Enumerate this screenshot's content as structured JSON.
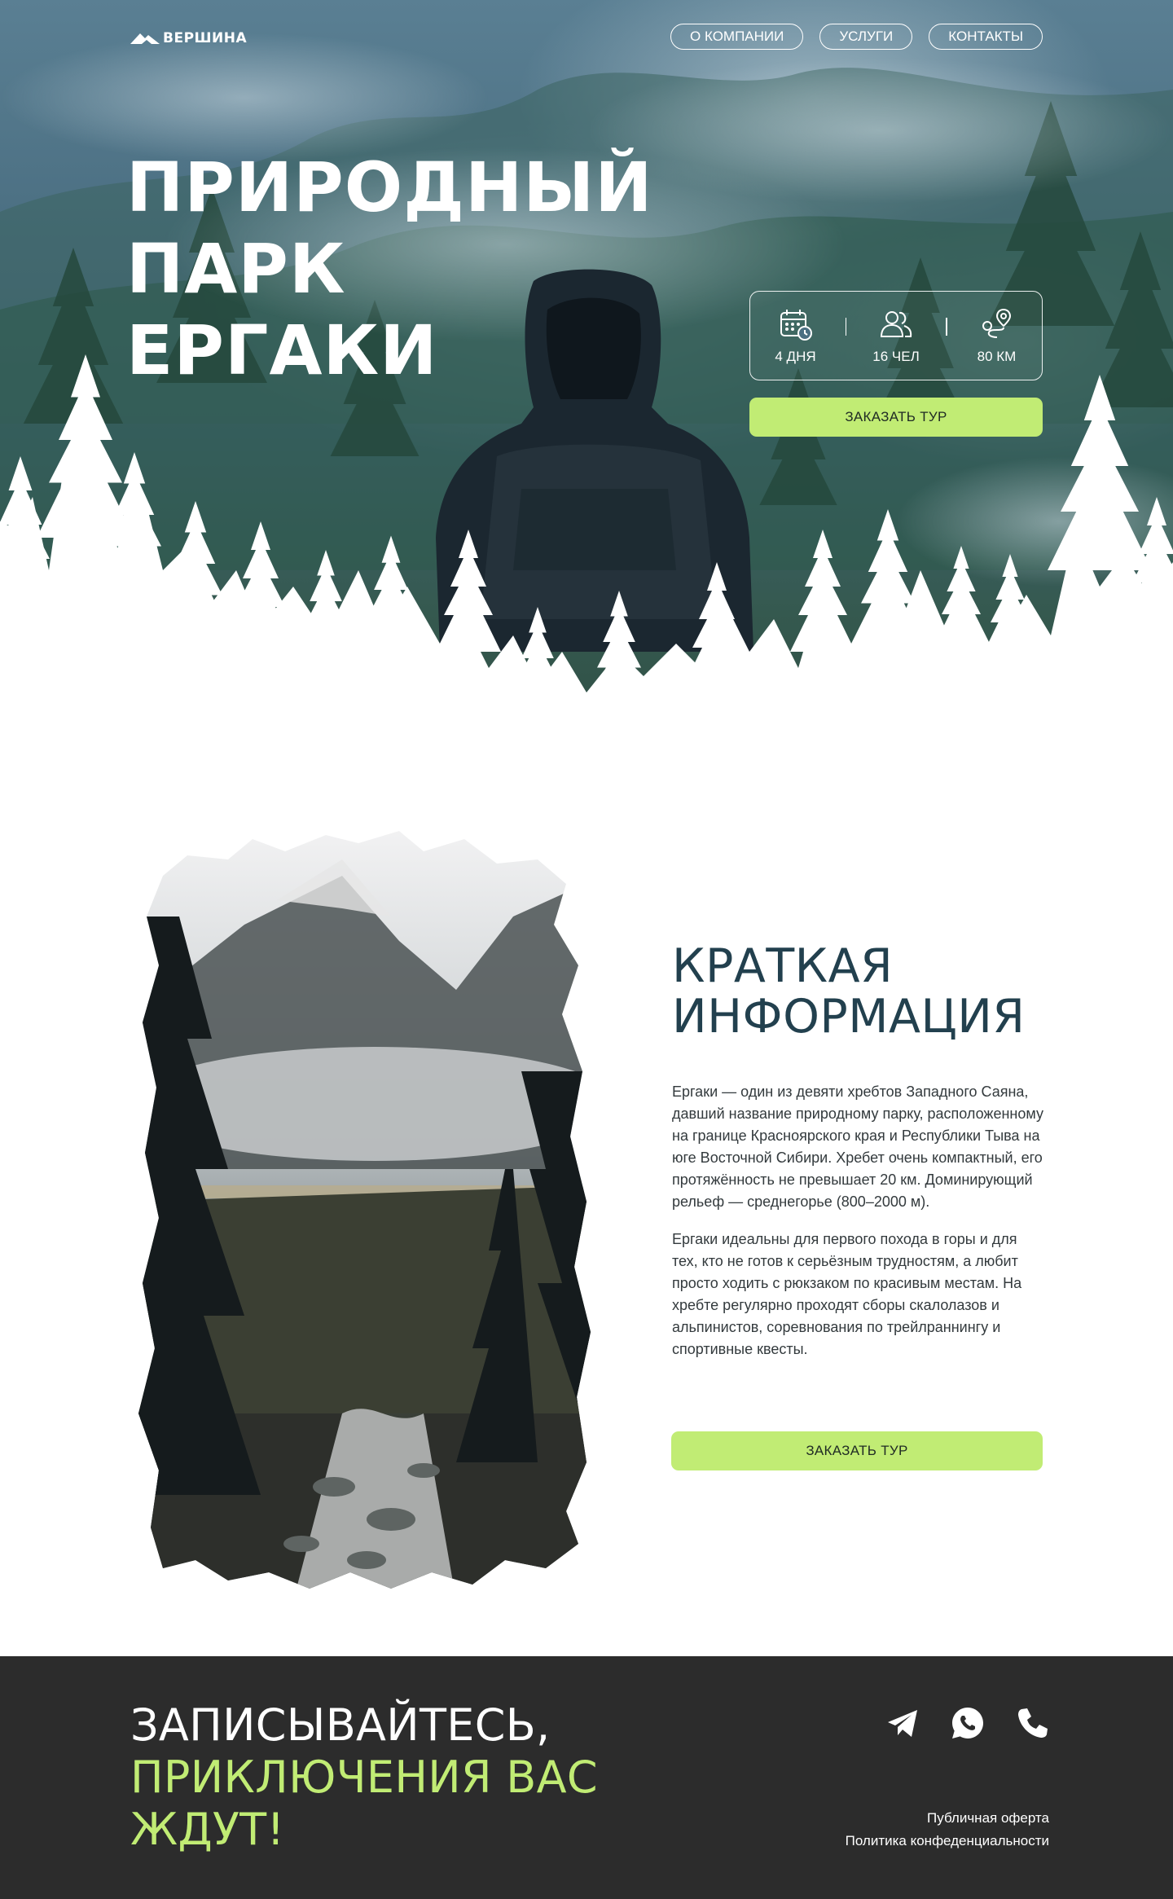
{
  "brand": {
    "name": "ВЕРШИНА"
  },
  "nav": {
    "items": [
      "О КОМПАНИИ",
      "УСЛУГИ",
      "КОНТАКТЫ"
    ]
  },
  "hero": {
    "title_lines": [
      "ПРИРОДНЫЙ",
      "ПАРК",
      "ЕРГАКИ"
    ],
    "stats": [
      {
        "icon": "calendar-clock-icon",
        "label": "4 ДНЯ"
      },
      {
        "icon": "group-icon",
        "label": "16 ЧЕЛ"
      },
      {
        "icon": "route-icon",
        "label": "80 КМ"
      }
    ],
    "cta_label": "ЗАКАЗАТЬ ТУР"
  },
  "info": {
    "title_lines": [
      "КРАТКАЯ",
      "ИНФОРМАЦИЯ"
    ],
    "paragraphs": [
      "Ергаки — один из девяти хребтов Западного Саяна, давший название природному парку, расположенному на границе Красноярского края и Республики Тыва на юге Восточной Сибири. Хребет очень компактный, его протяжённость не превышает 20 км. Доминирующий рельеф — среднегорье (800–2000 м).",
      "Ергаки идеальны для первого похода в горы и для тех, кто не готов к серьёзным трудностям, а любит просто ходить с рюкзаком по красивым местам. На хребте регулярно проходят сборы скалолазов и альпинистов, соревнования по трейлраннингу и спортивные квесты."
    ],
    "cta_label": "ЗАКАЗАТЬ ТУР"
  },
  "footer": {
    "title_line1": "ЗАПИСЫВАЙТЕСЬ,",
    "title_line2": "ПРИКЛЮЧЕНИЯ ВАС",
    "title_line3": "ЖДУТ!",
    "social_icons": [
      "telegram-icon",
      "whatsapp-icon",
      "phone-icon"
    ],
    "links": [
      "Публичная оферта",
      "Политика конфеденциальности"
    ]
  },
  "colors": {
    "accent": "#c1ec74",
    "heading": "#22404e",
    "footer_bg": "#2c2c2c",
    "hero_bg": "#4b6f82"
  }
}
